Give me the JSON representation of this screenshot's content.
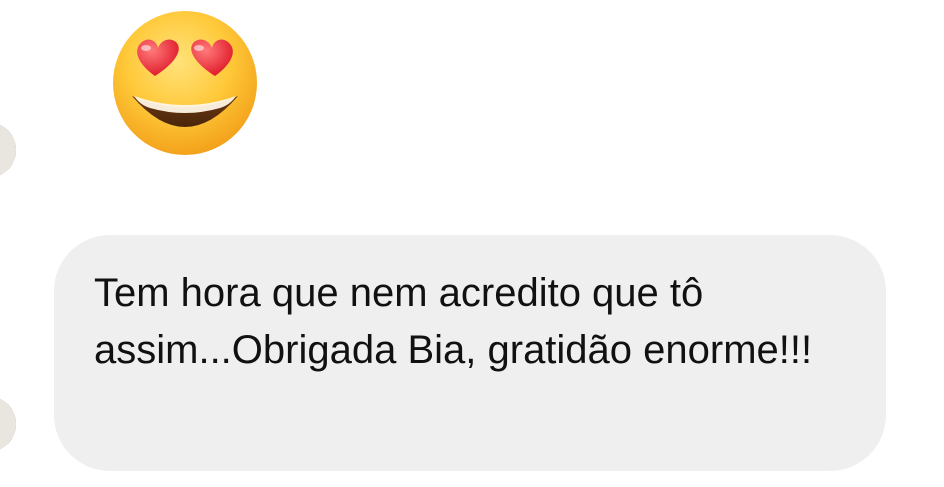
{
  "conversation": {
    "messages": [
      {
        "type": "emoji",
        "icon": "smiling-face-with-heart-eyes-icon"
      },
      {
        "type": "text",
        "text": "Tem hora que nem acredito que tô assim...Obrigada Bia, gratidão enorme!!!"
      }
    ]
  },
  "colors": {
    "background": "#ffffff",
    "bubble": "#efefef",
    "text": "#111111"
  }
}
